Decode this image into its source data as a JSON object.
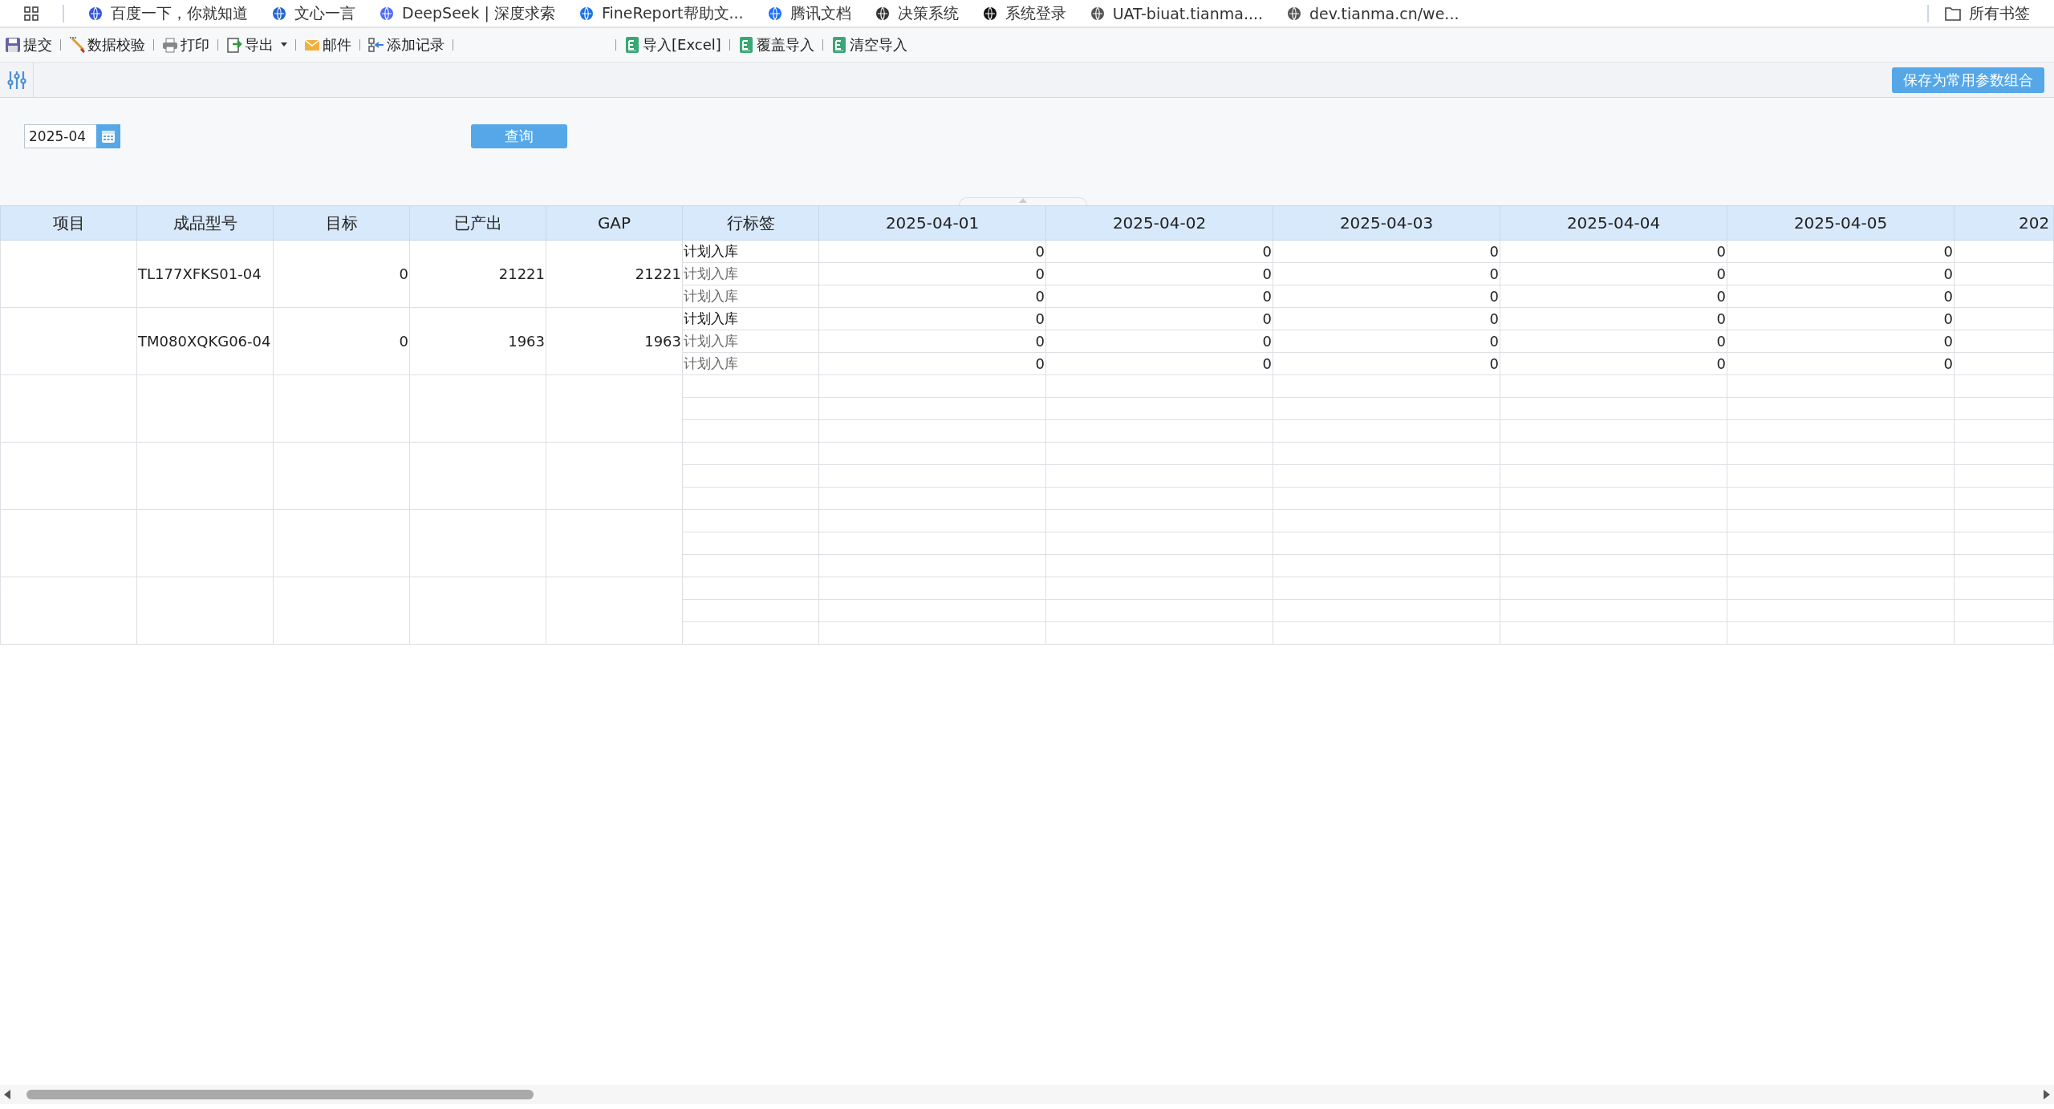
{
  "bookmarks": [
    {
      "label": "百度一下，你就知道"
    },
    {
      "label": "文心一言"
    },
    {
      "label": "DeepSeek | 深度求索"
    },
    {
      "label": "FineReport帮助文..."
    },
    {
      "label": "腾讯文档"
    },
    {
      "label": "决策系统"
    },
    {
      "label": "系统登录"
    },
    {
      "label": "UAT-biuat.tianma...."
    },
    {
      "label": "dev.tianma.cn/we..."
    }
  ],
  "all_bookmarks": "所有书签",
  "toolbar": {
    "left": [
      {
        "label": "提交",
        "kind": "save"
      },
      {
        "label": "数据校验",
        "kind": "check"
      },
      {
        "label": "打印",
        "kind": "print"
      },
      {
        "label": "导出",
        "kind": "export"
      },
      {
        "label": "邮件",
        "kind": "mail"
      },
      {
        "label": "添加记录",
        "kind": "add"
      }
    ],
    "right": [
      {
        "label": "导入[Excel]",
        "kind": "excel"
      },
      {
        "label": "覆盖导入",
        "kind": "excel"
      },
      {
        "label": "清空导入",
        "kind": "excel"
      }
    ]
  },
  "params": {
    "save_button": "保存为常用参数组合",
    "month": "2025-04",
    "query_button": "查询"
  },
  "table": {
    "columns": [
      "项目",
      "成品型号",
      "目标",
      "已产出",
      "GAP",
      "行标签",
      "2025-04-01",
      "2025-04-02",
      "2025-04-03",
      "2025-04-04",
      "2025-04-05",
      "202"
    ],
    "groups": [
      {
        "model": "TL177XFKS01-04",
        "target": "0",
        "produced": "21221",
        "gap": "21221",
        "rows": [
          {
            "label": "计划入库",
            "values": [
              "0",
              "0",
              "0",
              "0",
              "0"
            ]
          },
          {
            "label": "计划入库",
            "values": [
              "0",
              "0",
              "0",
              "0",
              "0"
            ]
          },
          {
            "label": "计划入库",
            "values": [
              "0",
              "0",
              "0",
              "0",
              "0"
            ]
          }
        ]
      },
      {
        "model": "TM080XQKG06-04",
        "target": "0",
        "produced": "1963",
        "gap": "1963",
        "rows": [
          {
            "label": "计划入库",
            "values": [
              "0",
              "0",
              "0",
              "0",
              "0"
            ]
          },
          {
            "label": "计划入库",
            "values": [
              "0",
              "0",
              "0",
              "0",
              "0"
            ]
          },
          {
            "label": "计划入库",
            "values": [
              "0",
              "0",
              "0",
              "0",
              "0"
            ]
          }
        ]
      }
    ]
  }
}
